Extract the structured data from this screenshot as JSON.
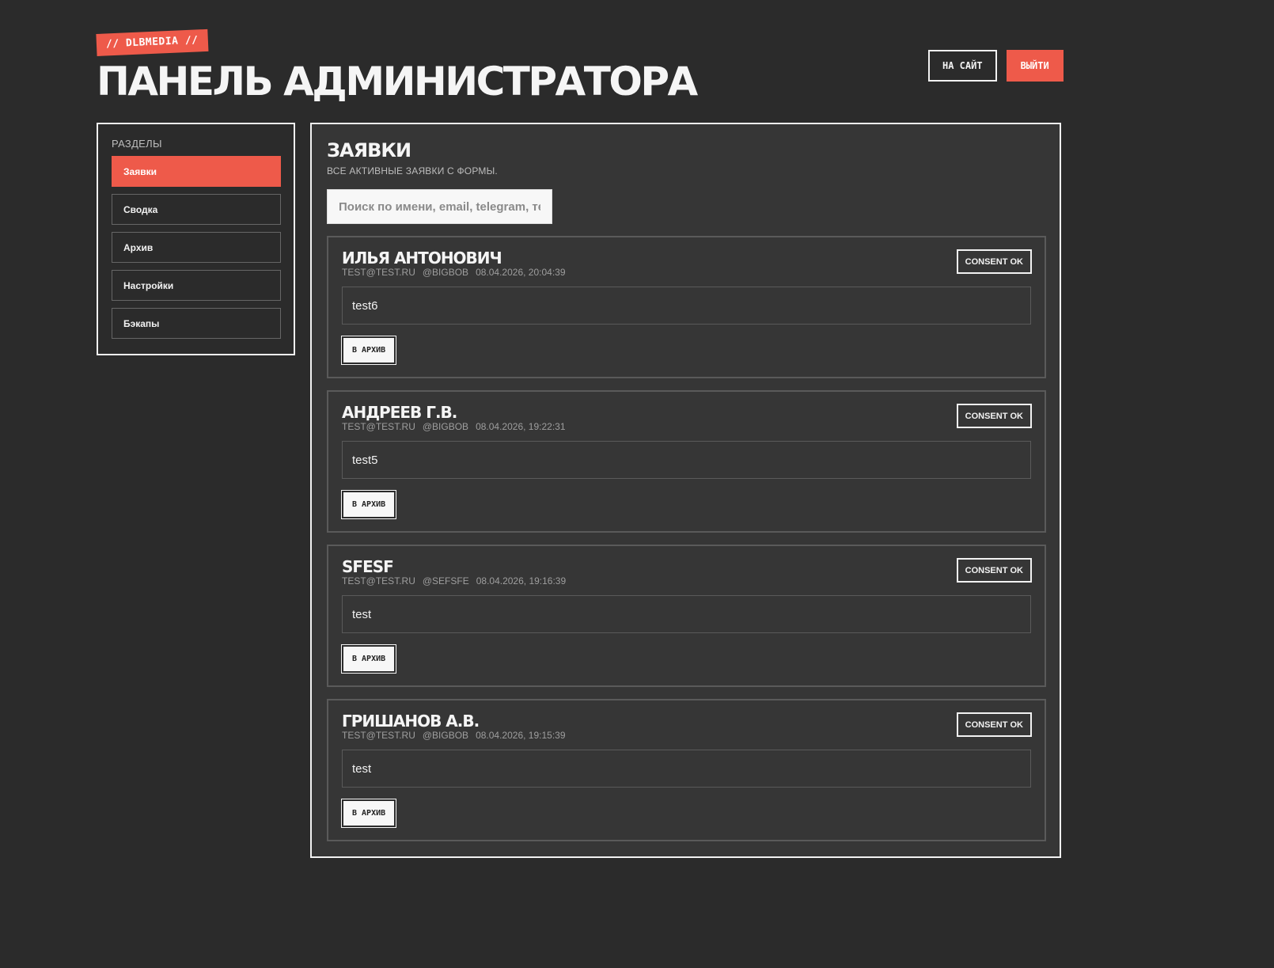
{
  "header": {
    "brand": "// DLBMEDIA //",
    "title": "ПАНЕЛЬ АДМИНИСТРАТОРА",
    "site_button": "НА САЙТ",
    "logout_button": "ВЫЙТИ"
  },
  "sidebar": {
    "title": "РАЗДЕЛЫ",
    "items": [
      {
        "label": "Заявки",
        "active": true
      },
      {
        "label": "Сводка",
        "active": false
      },
      {
        "label": "Архив",
        "active": false
      },
      {
        "label": "Настройки",
        "active": false
      },
      {
        "label": "Бэкапы",
        "active": false
      }
    ]
  },
  "main": {
    "title": "ЗАЯВКИ",
    "subtitle": "ВСЕ АКТИВНЫЕ ЗАЯВКИ С ФОРМЫ.",
    "search_placeholder": "Поиск по имени, email, telegram, тексту",
    "leads": [
      {
        "name": "ИЛЬЯ АНТОНОВИЧ",
        "email": "TEST@TEST.RU",
        "telegram": "@BIGBOB",
        "date": "08.04.2026, 20:04:39",
        "consent": "CONSENT OK",
        "message": "test6",
        "archive_label": "В АРХИВ"
      },
      {
        "name": "АНДРЕЕВ Г.В.",
        "email": "TEST@TEST.RU",
        "telegram": "@BIGBOB",
        "date": "08.04.2026, 19:22:31",
        "consent": "CONSENT OK",
        "message": "test5",
        "archive_label": "В АРХИВ"
      },
      {
        "name": "SFESF",
        "email": "TEST@TEST.RU",
        "telegram": "@SEFSFE",
        "date": "08.04.2026, 19:16:39",
        "consent": "CONSENT OK",
        "message": "test",
        "archive_label": "В АРХИВ"
      },
      {
        "name": "ГРИШАНОВ А.В.",
        "email": "TEST@TEST.RU",
        "telegram": "@BIGBOB",
        "date": "08.04.2026, 19:15:39",
        "consent": "CONSENT OK",
        "message": "test",
        "archive_label": "В АРХИВ"
      }
    ]
  },
  "colors": {
    "background": "#2b2b2b",
    "panel": "#363636",
    "accent": "#ee5a4a",
    "text": "#f2f2f2"
  }
}
